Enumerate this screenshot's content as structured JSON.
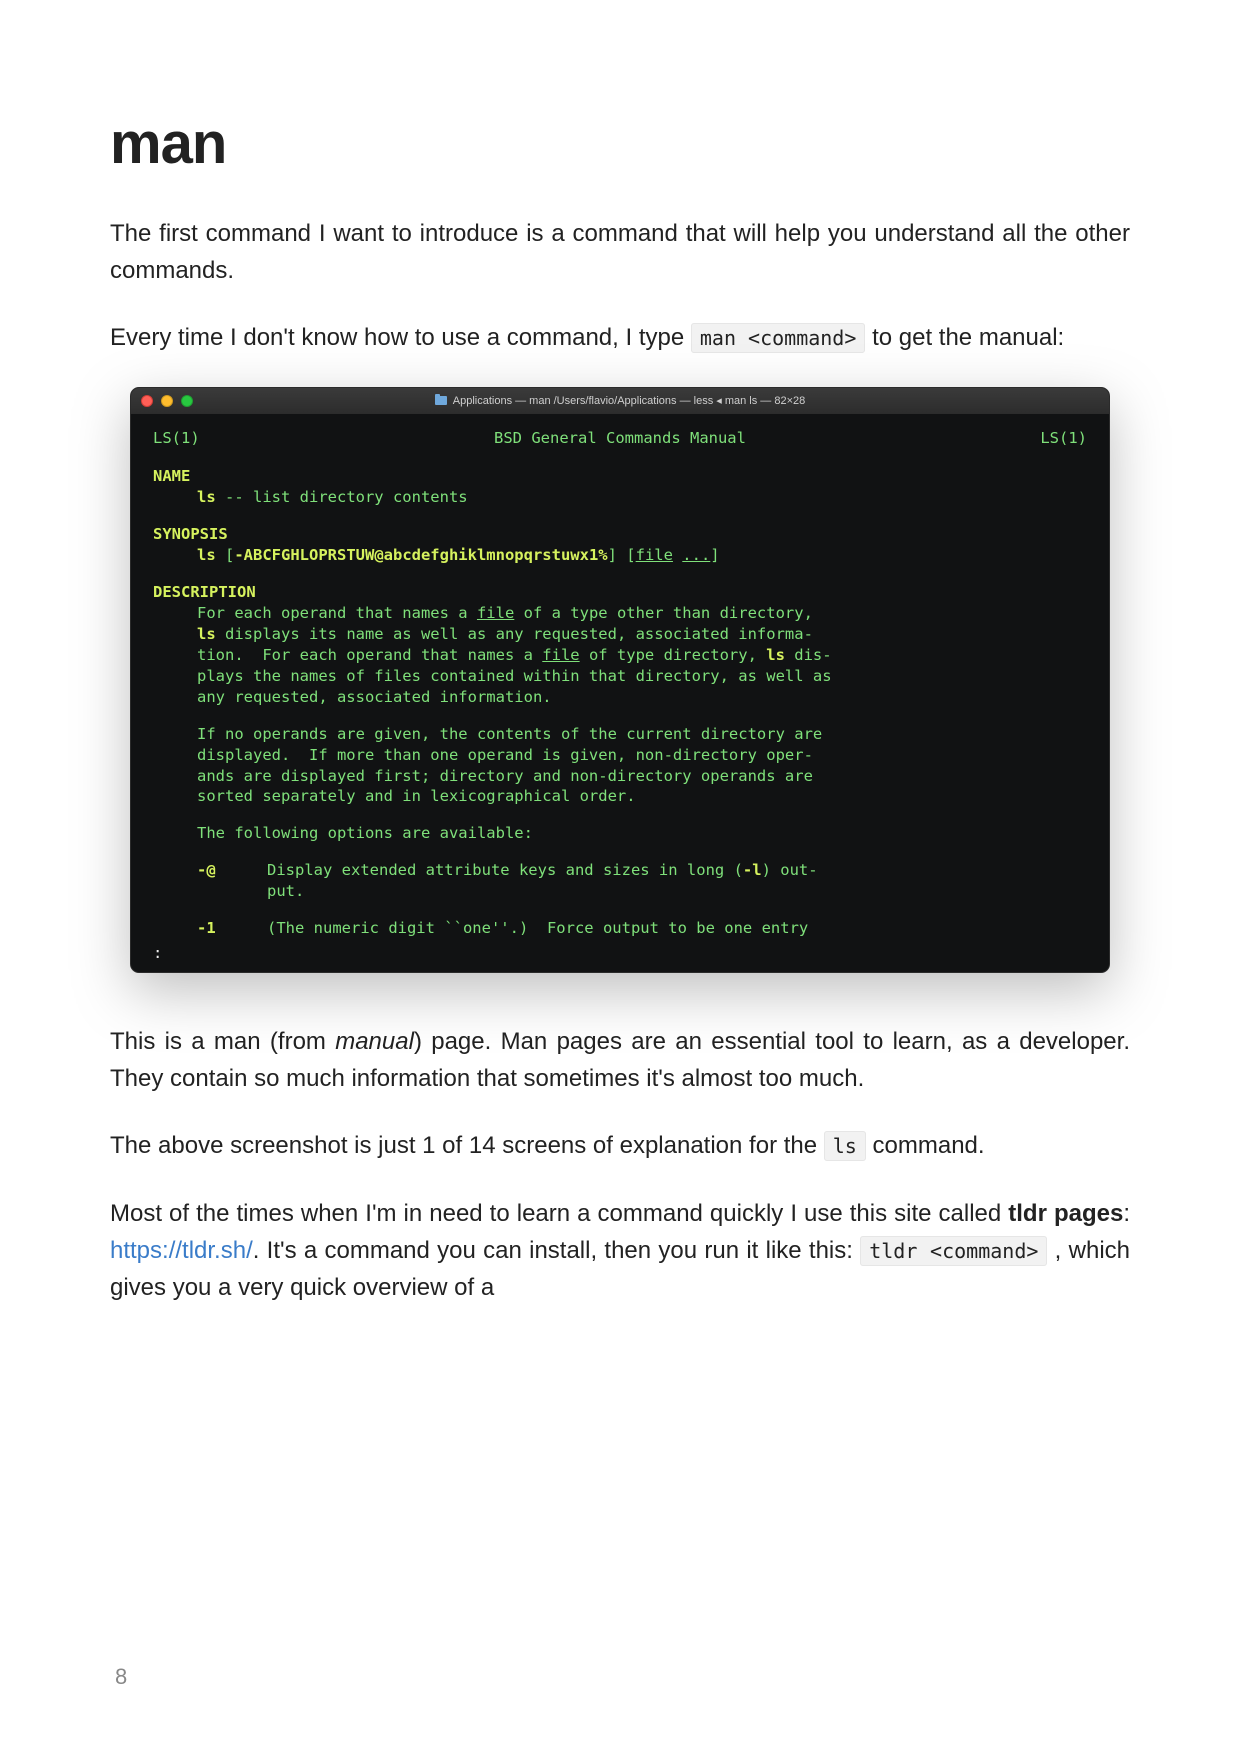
{
  "heading": "man",
  "p1": "The first command I want to introduce is a command that will help you understand all the other commands.",
  "p2_a": "Every time I don't know how to use a command, I type ",
  "p2_code": "man <command>",
  "p2_b": " to get the manual:",
  "terminal": {
    "window_title": "Applications — man /Users/flavio/Applications — less ◂ man ls — 82×28",
    "hdr_left": "LS(1)",
    "hdr_center": "BSD General Commands Manual",
    "hdr_right": "LS(1)",
    "sect_name": "NAME",
    "name_cmd": "ls",
    "name_rest": " -- list directory contents",
    "sect_synopsis": "SYNOPSIS",
    "syn_cmd": "ls",
    "syn_opts": " [",
    "syn_flags": "-ABCFGHLOPRSTUW@abcdefghiklmnopqrstuwx1%",
    "syn_close": "] [",
    "syn_file": "file",
    "syn_dots": " ",
    "syn_ellipsis": "...",
    "syn_end": "]",
    "sect_desc": "DESCRIPTION",
    "desc_l1a": "For each operand that names a ",
    "desc_l1_file": "file",
    "desc_l1b": " of a type other than directory,",
    "desc_l2a": "ls",
    "desc_l2b": " displays its name as well as any requested, associated informa-",
    "desc_l3a": "tion.  For each operand that names a ",
    "desc_l3_file": "file",
    "desc_l3b": " of type directory, ",
    "desc_l3_ls": "ls",
    "desc_l3c": " dis-",
    "desc_l4": "plays the names of files contained within that directory, as well as",
    "desc_l5": "any requested, associated information.",
    "desc_p2_l1": "If no operands are given, the contents of the current directory are",
    "desc_p2_l2": "displayed.  If more than one operand is given, non-directory oper-",
    "desc_p2_l3": "ands are displayed first; directory and non-directory operands are",
    "desc_p2_l4": "sorted separately and in lexicographical order.",
    "desc_p3": "The following options are available:",
    "opt1_flag": "-@",
    "opt1_l1": "Display extended attribute keys and sizes in long (",
    "opt1_l": "-l",
    "opt1_l1b": ") out-",
    "opt1_l2": "put.",
    "opt2_flag": "-1",
    "opt2_l1": "(The numeric digit ``one''.)  Force output to be one entry",
    "prompt": ":"
  },
  "p3_a": "This is a man (from ",
  "p3_i": "manual",
  "p3_b": ") page. Man pages are an essential tool to learn, as a developer. They contain so much information that sometimes it's almost too much.",
  "p4_a": "The above screenshot is just 1 of 14 screens of explanation for the ",
  "p4_code": "ls",
  "p4_b": " command.",
  "p5_a": "Most of the times when I'm in need to learn a command quickly I use this site called ",
  "p5_bold": "tldr pages",
  "p5_b": ": ",
  "p5_link": "https://tldr.sh/",
  "p5_c": ". It's a command you can install, then you run it like this: ",
  "p5_code": "tldr <command>",
  "p5_d": " , which gives you a very quick overview of a",
  "page_number": "8"
}
